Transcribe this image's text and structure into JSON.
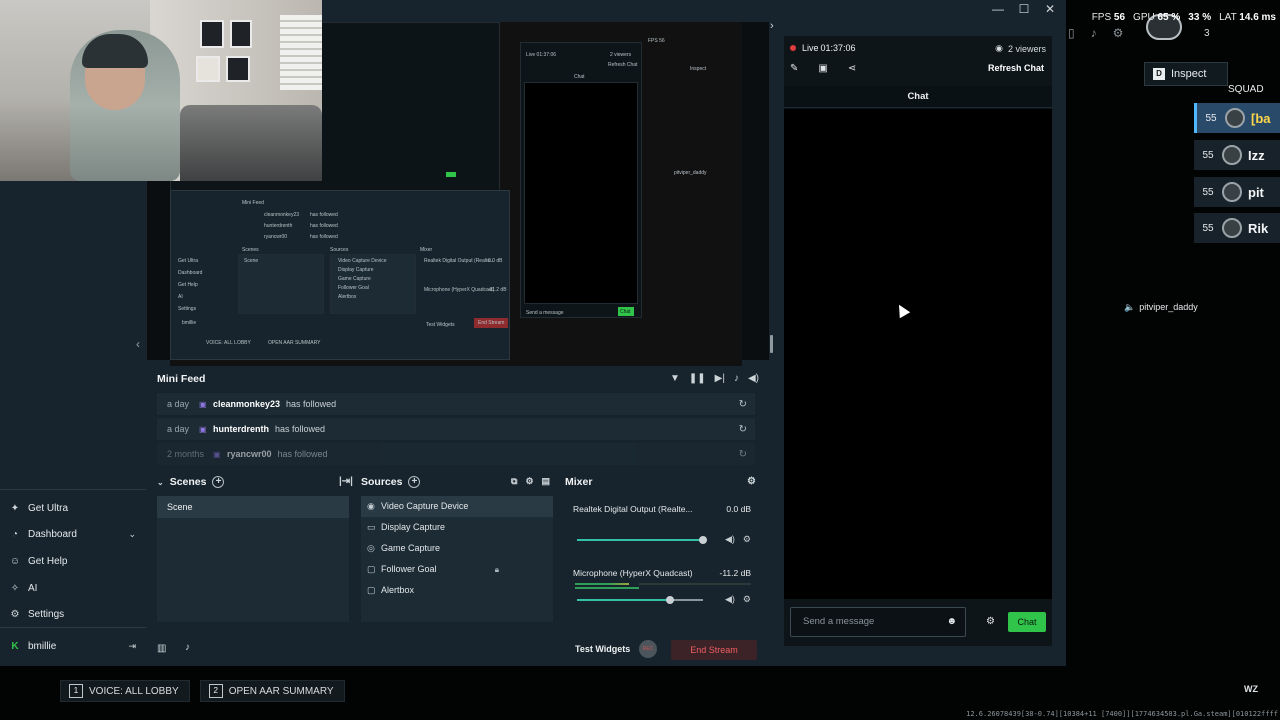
{
  "window": {
    "controls": [
      "—",
      "☐",
      "✕"
    ]
  },
  "hud": {
    "fps_label": "FPS",
    "fps_value": "56",
    "gpu_label": "GPU",
    "gpu_value": "65 %",
    "cpu_value": "33 %",
    "lat_label": "LAT",
    "lat_value": "14.6 ms",
    "count_value": "3",
    "inspect_key": "D",
    "inspect_label": "Inspect",
    "squad_title": "SQUAD",
    "squad": [
      {
        "level": "55",
        "name": "[ba"
      },
      {
        "level": "55",
        "name": "Izz"
      },
      {
        "level": "55",
        "name": "pit"
      },
      {
        "level": "55",
        "name": "Rik"
      }
    ],
    "speaker_name": "pitviper_daddy",
    "hints": [
      {
        "key": "1",
        "label": "VOICE: ALL LOBBY"
      },
      {
        "key": "2",
        "label": "OPEN AAR SUMMARY"
      }
    ],
    "wz_logo": "WZ",
    "debug_text": "12.6.26078439[38-0.74][10384+11 [7400]][1774634503.pl.Ga.steam][010122ffff"
  },
  "nav": {
    "items": [
      {
        "label": "Get Ultra",
        "icon": "ultra-icon"
      },
      {
        "label": "Dashboard",
        "icon": "dashboard-icon"
      },
      {
        "label": "Get Help",
        "icon": "help-icon"
      },
      {
        "label": "AI",
        "icon": "ai-icon"
      },
      {
        "label": "Settings",
        "icon": "gear-icon"
      }
    ],
    "user": "bmillie"
  },
  "minifeed": {
    "title": "Mini Feed",
    "rows": [
      {
        "time": "a day",
        "user": "cleanmonkey23",
        "action": "has followed"
      },
      {
        "time": "a day",
        "user": "hunterdrenth",
        "action": "has followed"
      },
      {
        "time": "2 months",
        "user": "ryancwr00",
        "action": "has followed"
      }
    ]
  },
  "scenes": {
    "title": "Scenes",
    "items": [
      "Scene"
    ]
  },
  "sources": {
    "title": "Sources",
    "items": [
      "Video Capture Device",
      "Display Capture",
      "Game Capture",
      "Follower Goal",
      "Alertbox"
    ]
  },
  "mixer": {
    "title": "Mixer",
    "channels": [
      {
        "name": "Realtek Digital Output (Realte...",
        "db": "0.0 dB",
        "level": 1.0
      },
      {
        "name": "Microphone (HyperX Quadcast)",
        "db": "-11.2 dB",
        "level": 0.74
      }
    ]
  },
  "footer": {
    "test_widgets": "Test Widgets",
    "rec": "REC",
    "end_stream": "End Stream"
  },
  "chat": {
    "live_label": "Live",
    "live_time": "01:37:06",
    "viewers": "2 viewers",
    "refresh": "Refresh Chat",
    "header": "Chat",
    "input_placeholder": "Send a message",
    "send_label": "Chat"
  },
  "preview_text": {
    "mini_feed": "Mini Feed",
    "feed_rows": [
      {
        "user": "cleanmonkey23",
        "action": "has followed"
      },
      {
        "user": "hunterdrenth",
        "action": "has followed"
      },
      {
        "user": "ryancwr00",
        "action": "has followed"
      }
    ],
    "scenes": "Scenes",
    "sources": "Sources",
    "mixer": "Mixer",
    "scene_item": "Scene",
    "source_items": [
      "Video Capture Device",
      "Display Capture",
      "Game Capture",
      "Follower Goal",
      "Alertbox"
    ],
    "mix1": "Realtek Digital Output (Realte...",
    "mix1_db": "0.0 dB",
    "mix2": "Microphone (HyperX Quadcast)",
    "mix2_db": "-11.2 dB",
    "nav": [
      "Get Ultra",
      "Dashboard",
      "Get Help",
      "AI",
      "Settings"
    ],
    "user": "bmillie",
    "test_widgets": "Test Widgets",
    "end_stream": "End Stream",
    "chat": "Chat",
    "live": "Live 01:37:06",
    "viewers": "2 viewers",
    "refresh": "Refresh Chat",
    "send": "Send a message",
    "chat_btn": "Chat",
    "inspect": "Inspect",
    "speaker": "pitviper_daddy",
    "hint1": "VOICE: ALL LOBBY",
    "hint2": "OPEN AAR SUMMARY",
    "fps": "FPS 56"
  }
}
